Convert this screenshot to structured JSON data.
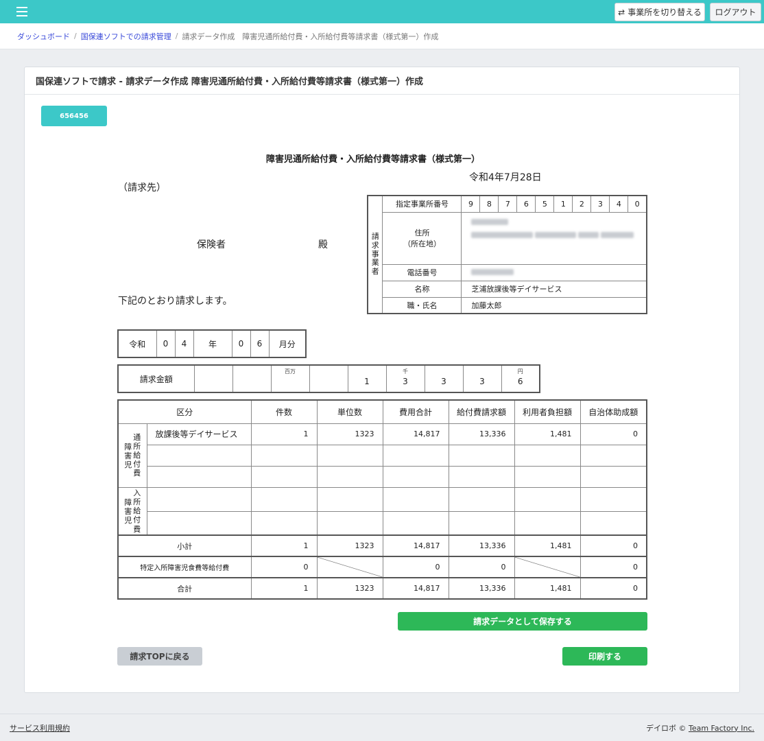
{
  "topbar": {
    "switch_label": "事業所を切り替える",
    "logout_label": "ログアウト",
    "accent": "#3cc8c8"
  },
  "breadcrumb": {
    "dashboard": "ダッシュボード",
    "billing": "国保連ソフトでの請求管理",
    "current": "請求データ作成　障害児通所給付費・入所給付費等請求書（様式第一）作成"
  },
  "card": {
    "title": "国保連ソフトで請求 - 請求データ作成 障害児通所給付費・入所給付費等請求書（様式第一）作成",
    "badge": "656456"
  },
  "form": {
    "title": "障害児通所給付費・入所給付費等請求書（様式第一）",
    "date": "令和4年7月28日",
    "bill_to": "（請求先）",
    "insurer": "保険者",
    "honorific": "殿",
    "request_text": "下記のとおり請求します。"
  },
  "provider": {
    "vertical_label": [
      "請",
      "求",
      "事",
      "業",
      "者"
    ],
    "office_number_label": "指定事業所番号",
    "office_number_digits": [
      "9",
      "8",
      "7",
      "6",
      "5",
      "1",
      "2",
      "3",
      "4",
      "0"
    ],
    "address_label_1": "住所",
    "address_label_2": "（所在地）",
    "phone_label": "電話番号",
    "name_label": "名称",
    "name_value": "芝浦放課後等デイサービス",
    "rep_label": "職・氏名",
    "rep_value": "加藤太郎"
  },
  "period": {
    "era": "令和",
    "year_digits": [
      "0",
      "4"
    ],
    "year_label": "年",
    "month_digits": [
      "0",
      "6"
    ],
    "month_label": "月分"
  },
  "amount": {
    "label": "請求金額",
    "units": [
      "",
      "",
      "百万",
      "",
      "",
      "千",
      "",
      "",
      "円"
    ],
    "digits": [
      "",
      "",
      "",
      "",
      "1",
      "3",
      "3",
      "3",
      "6"
    ]
  },
  "table": {
    "headers": [
      "区分",
      "件数",
      "単位数",
      "費用合計",
      "給付費請求額",
      "利用者負担額",
      "自治体助成額"
    ],
    "group1_cols": [
      [
        "障",
        "害",
        "児"
      ],
      [
        "通",
        "所",
        "給",
        "付",
        "費"
      ]
    ],
    "group2_cols": [
      [
        "障",
        "害",
        "児"
      ],
      [
        "入",
        "所",
        "給",
        "付",
        "費"
      ]
    ],
    "service_row": {
      "name": "放課後等デイサービス",
      "count": "1",
      "units": "1323",
      "cost": "14,817",
      "benefit": "13,336",
      "user": "1,481",
      "subsidy": "0"
    },
    "subtotal": {
      "label": "小計",
      "count": "1",
      "units": "1323",
      "cost": "14,817",
      "benefit": "13,336",
      "user": "1,481",
      "subsidy": "0"
    },
    "special": {
      "label": "特定入所障害児食費等給付費",
      "count": "0",
      "cost": "0",
      "benefit": "0",
      "subsidy": "0"
    },
    "total": {
      "label": "合計",
      "count": "1",
      "units": "1323",
      "cost": "14,817",
      "benefit": "13,336",
      "user": "1,481",
      "subsidy": "0"
    }
  },
  "actions": {
    "save_label": "請求データとして保存する",
    "print_label": "印刷する",
    "back_label": "請求TOPに戻る",
    "green": "#2db858"
  },
  "footer": {
    "terms": "サービス利用規約",
    "brand": "デイロボ ©",
    "company": "Team Factory Inc."
  }
}
